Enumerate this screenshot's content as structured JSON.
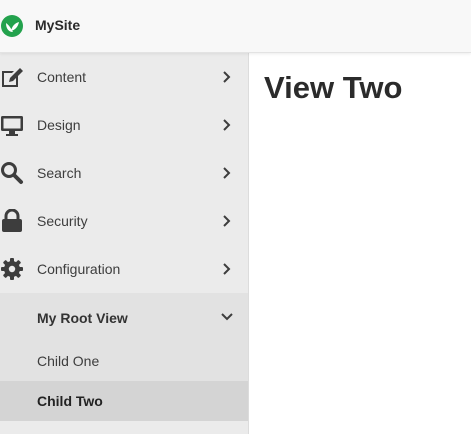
{
  "header": {
    "site_name": "MySite"
  },
  "sidebar": {
    "items": [
      {
        "label": "Content",
        "icon": "edit-icon"
      },
      {
        "label": "Design",
        "icon": "monitor-icon"
      },
      {
        "label": "Search",
        "icon": "search-icon"
      },
      {
        "label": "Security",
        "icon": "lock-icon"
      },
      {
        "label": "Configuration",
        "icon": "gear-icon"
      }
    ],
    "group": {
      "label": "My Root View",
      "children": [
        {
          "label": "Child One"
        },
        {
          "label": "Child Two"
        }
      ]
    }
  },
  "main": {
    "title": "View Two"
  },
  "colors": {
    "logo_green": "#23a24d",
    "active_bg": "#d4d4d4",
    "sidebar_bg": "#ebebeb"
  }
}
